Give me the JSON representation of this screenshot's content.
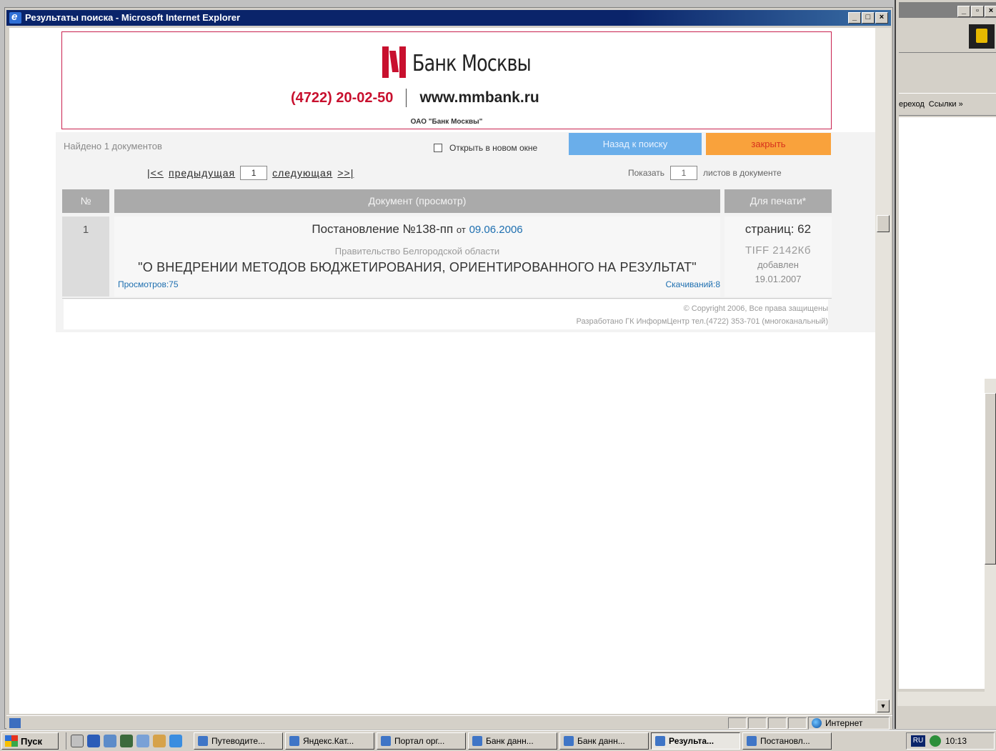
{
  "window": {
    "title": "Результаты поиска - Microsoft Internet Explorer",
    "status_zone": "Интернет"
  },
  "banner": {
    "bank_name": "Банк Москвы",
    "phone": "(4722) 20-02-50",
    "website": "www.mmbank.ru",
    "company": "ОАО \"Банк Москвы\""
  },
  "search": {
    "found_text": "Найдено 1 документов",
    "new_window_label": "Открыть в новом окне",
    "back_button": "Назад к поиску",
    "close_button": "закрыть"
  },
  "pager": {
    "first": "|<<",
    "prev": "предыдущая",
    "page": "1",
    "next": "следующая",
    "last": ">>|",
    "show_label": "Показать",
    "sheets_count": "1",
    "sheets_label": "листов в документе"
  },
  "table": {
    "headers": {
      "num": "№",
      "doc": "Документ (просмотр)",
      "print": "Для печати*"
    },
    "rows": [
      {
        "num": "1",
        "title": "Постановление №138-пп",
        "date_prefix": "от",
        "date": "09.06.2006",
        "org": "Правительство Белгородской области",
        "name": "\"О ВНЕДРЕНИИ МЕТОДОВ БЮДЖЕТИРОВАНИЯ, ОРИЕНТИРОВАННОГО НА РЕЗУЛЬТАТ\"",
        "views": "Просмотров:75",
        "downloads": "Скачиваний:8",
        "pages": "страниц: 62",
        "format_size": "TIFF  2142Кб",
        "added_label": "добавлен",
        "added_date": "19.01.2007"
      }
    ]
  },
  "footer": {
    "copyright": "© Copyright 2006, Все права защищены",
    "developer": "Разработано ГК ИнформЦентр тел.(4722) 353-701 (многоканальный)"
  },
  "bg_window": {
    "links_left": "ереход",
    "links_right": "Ссылки »"
  },
  "taskbar": {
    "start": "Пуск",
    "tasks": [
      "Путеводите...",
      "Яндекс.Кат...",
      "Портал орг...",
      "Банк данн...",
      "Банк данн...",
      "Результа...",
      "Постановл..."
    ],
    "lang": "RU",
    "clock": "10:13"
  },
  "colors": {
    "brand_red": "#c8102e",
    "link_blue": "#1e6fb0",
    "back_button_bg": "#6aaeea",
    "close_button_bg": "#f9a23c",
    "titlebar": "#0a246a"
  }
}
